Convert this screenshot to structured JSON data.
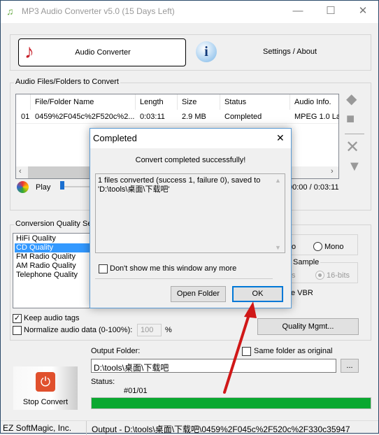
{
  "window": {
    "title": "MP3 Audio Converter v5.0 (15 Days Left)"
  },
  "tabs": [
    {
      "label": "Audio Converter",
      "icon": "music-note-icon"
    },
    {
      "label": "Settings / About",
      "icon": "info-icon"
    }
  ],
  "files": {
    "group_label": "Audio Files/Folders to Convert",
    "columns": [
      "",
      "File/Folder Name",
      "Length",
      "Size",
      "Status",
      "Audio Info."
    ],
    "rows": [
      [
        "01",
        "0459%2F045c%2F520c%2...",
        "0:03:11",
        "2.9 MB",
        "Completed",
        "MPEG 1.0 La"
      ]
    ]
  },
  "player": {
    "play_label": "Play",
    "time": "00:00 / 0:03:11"
  },
  "quality": {
    "group_label": "Conversion Quality Set",
    "items": [
      "HiFi Quality",
      "CD Quality",
      "FM Radio Quality",
      "AM Radio Quality",
      "Telephone Quality"
    ],
    "selected": "CD Quality",
    "stereo_partial": "o",
    "mono_label": "Mono",
    "sample_label": "Sample",
    "sample_partial": "s",
    "bits_label": "16-bits",
    "vbr_partial": "e VBR",
    "quality_mgmt": "Quality Mgmt..."
  },
  "options": {
    "keep_tags": "Keep audio tags",
    "keep_tags_checked": true,
    "normalize": "Normalize audio data (0-100%):",
    "normalize_checked": false,
    "normalize_value": "100",
    "percent": "%"
  },
  "output": {
    "label": "Output Folder:",
    "same_folder": "Same folder as original",
    "path": "D:\\tools\\桌面\\下载吧",
    "browse": "..."
  },
  "status": {
    "label": "Status:",
    "counter": "#01/01",
    "progress": 100,
    "progress_color": "#0aa830"
  },
  "stop_button": "Stop Convert",
  "statusbar": {
    "company": "EZ SoftMagic, Inc.",
    "output": "Output - D:\\tools\\桌面\\下载吧\\0459%2F045c%2F520c%2F330c35947"
  },
  "dialog": {
    "title": "Completed",
    "message": "Convert completed successfully!",
    "details": "1 files converted (success 1, failure 0), saved to 'D:\\tools\\桌面\\下载吧'",
    "dont_show": "Don't show me this window any more",
    "open_folder": "Open Folder",
    "ok": "OK"
  }
}
